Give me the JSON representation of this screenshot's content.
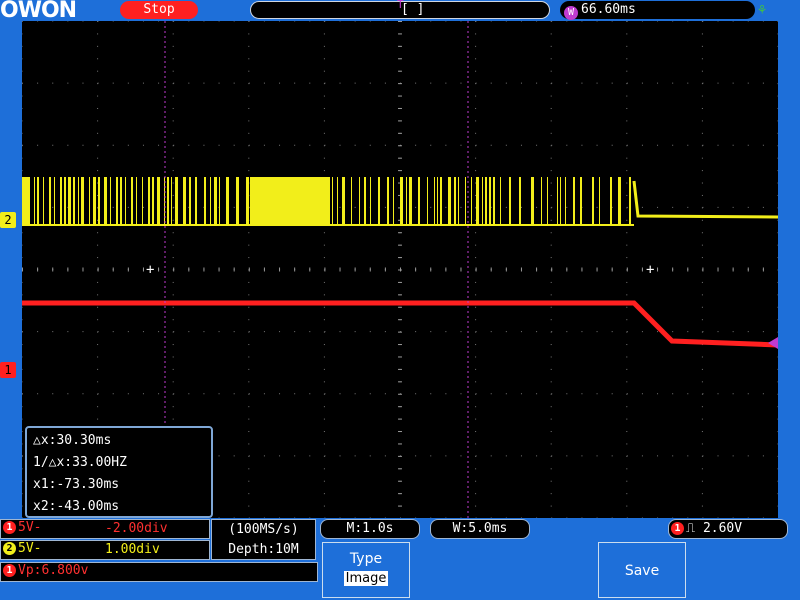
{
  "header": {
    "brand": "OWON",
    "run_state": "Stop",
    "trigger_marker": "T",
    "window_indicator": "[ ]",
    "window_icon": "W",
    "time_value": "66.60ms",
    "usb_icon": "usb-icon"
  },
  "markers": {
    "ch2_label": "2",
    "ch1_label": "1"
  },
  "measure": {
    "dx": "△x:30.30ms",
    "inv_dx": "1/△x:33.00HZ",
    "x1": "x1:-73.30ms",
    "x2": "x2:-43.00ms"
  },
  "channels": [
    {
      "badge": "1",
      "volts": "5V-",
      "offset": "-2.00div"
    },
    {
      "badge": "2",
      "volts": "5V-",
      "offset": "1.00div"
    }
  ],
  "acq": {
    "rate": "(100MS/s)",
    "depth": "Depth:10M"
  },
  "timebase": {
    "main": "M:1.0s",
    "window": "W:5.0ms"
  },
  "trigger": {
    "badge": "1",
    "level": "2.60V"
  },
  "measurement_bar": {
    "badge": "1",
    "value": "Vp:6.800v"
  },
  "menu": {
    "type_label": "Type",
    "type_value": "Image",
    "save_label": "Save"
  },
  "colors": {
    "ch1": "#ff2020",
    "ch2": "#f2ee1a",
    "frame": "#1e6fd9",
    "cursor": "#c03bd1"
  }
}
